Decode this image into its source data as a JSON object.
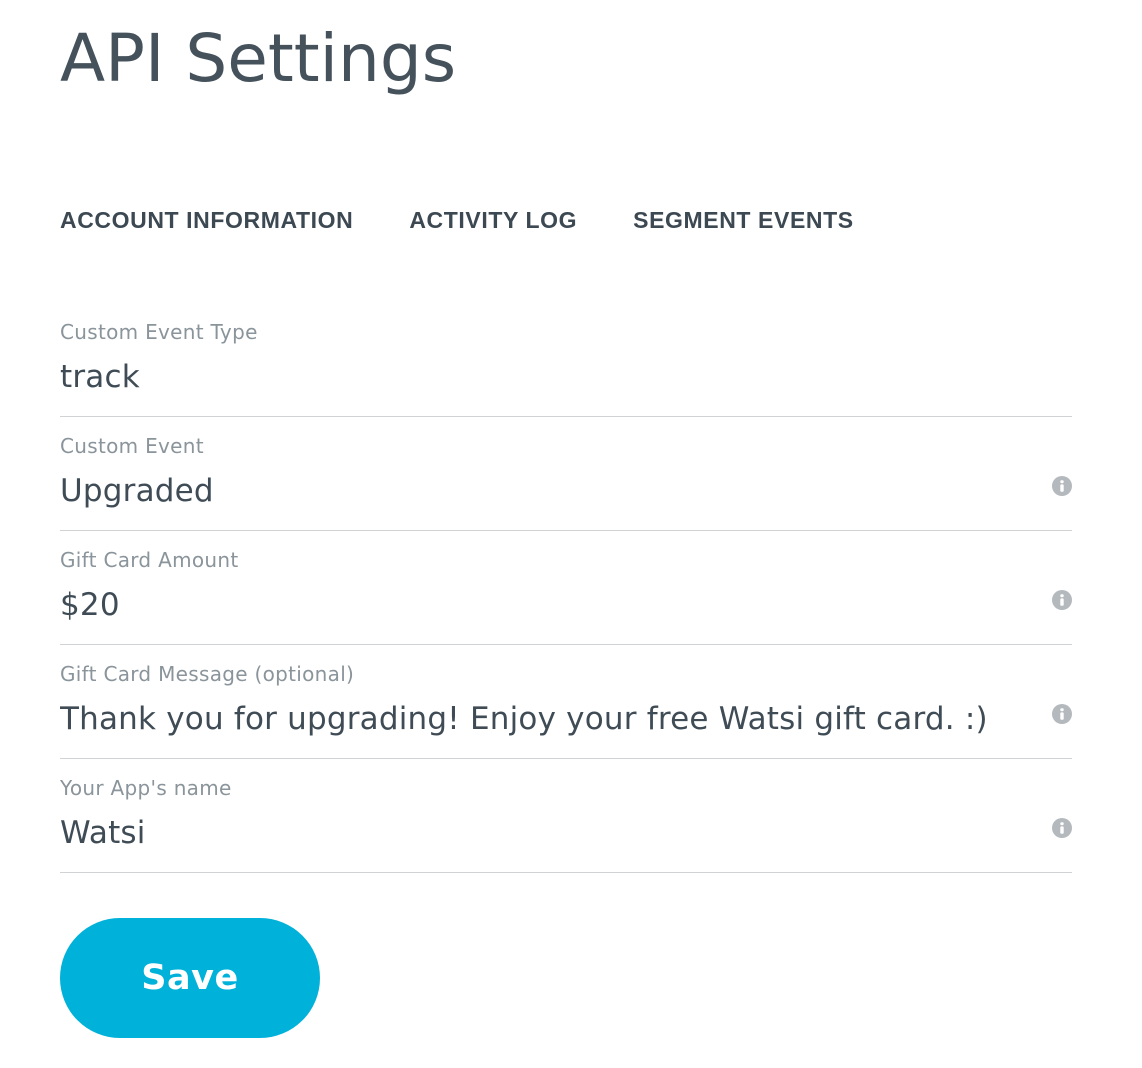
{
  "header": {
    "title": "API Settings"
  },
  "tabs": [
    {
      "label": "ACCOUNT INFORMATION"
    },
    {
      "label": "ACTIVITY LOG"
    },
    {
      "label": "SEGMENT EVENTS"
    }
  ],
  "form": {
    "fields": [
      {
        "label": "Custom Event Type",
        "value": "track",
        "has_info_icon": false
      },
      {
        "label": "Custom Event",
        "value": "Upgraded",
        "has_info_icon": true
      },
      {
        "label": "Gift Card Amount",
        "value": "$20",
        "has_info_icon": true
      },
      {
        "label": "Gift Card Message (optional)",
        "value": "Thank you for upgrading! Enjoy your free Watsi gift card. :)",
        "has_info_icon": true
      },
      {
        "label": "Your App's name",
        "value": "Watsi",
        "has_info_icon": true
      }
    ],
    "info_icon": "info-icon",
    "save_label": "Save"
  },
  "colors": {
    "accent": "#00b1d9",
    "text": "#3f4c56",
    "label": "#8a949b",
    "divider": "#cfd3d6",
    "icon": "#b4b9bd"
  }
}
